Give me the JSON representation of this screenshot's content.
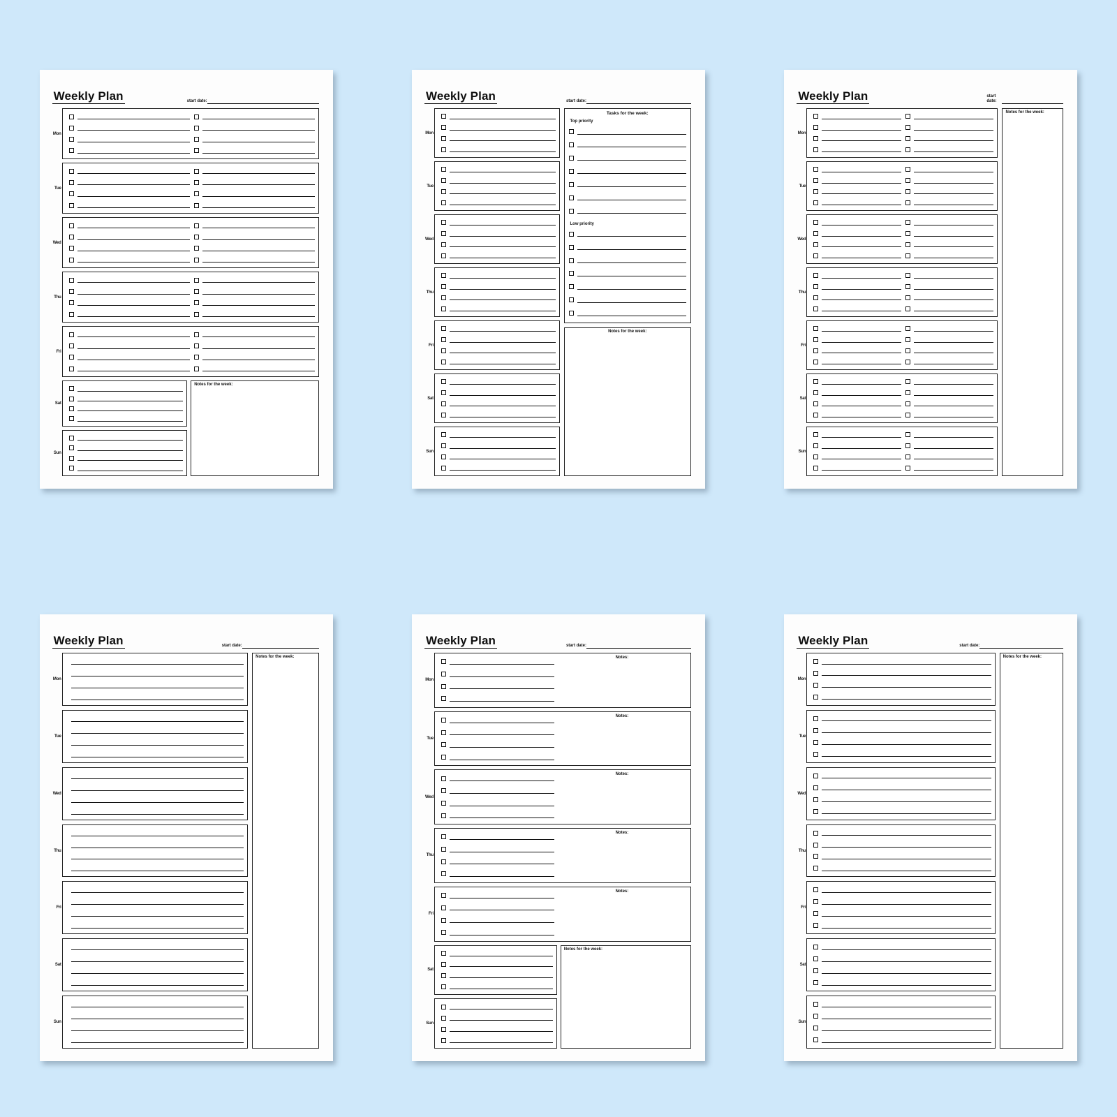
{
  "background_color": "#cfe8fa",
  "common": {
    "title": "Weekly Plan",
    "start_date_label": "start date:",
    "notes_week_label": "Notes for the week:",
    "notes_label": "Notes:",
    "days": [
      "Mon",
      "Tue",
      "Wed",
      "Thu",
      "Fri",
      "Sat",
      "Sun"
    ]
  },
  "pages": [
    {
      "id": "page-1",
      "variant": "two-column-checkbox-with-bottom-notes",
      "title": "Weekly Plan",
      "start_date_label": "start date:",
      "days": [
        "Mon",
        "Tue",
        "Wed",
        "Thu",
        "Fri",
        "Sat",
        "Sun"
      ],
      "rows_per_day": 4,
      "columns_per_row": 2,
      "weekend_columns": 1,
      "notes_week_label": "Notes for the week:"
    },
    {
      "id": "page-2",
      "variant": "single-column-with-tasks-panel",
      "title": "Weekly Plan",
      "start_date_label": "start date:",
      "days": [
        "Mon",
        "Tue",
        "Wed",
        "Thu",
        "Fri",
        "Sat",
        "Sun"
      ],
      "rows_per_day": 4,
      "columns_per_row": 1,
      "tasks_title": "Tasks for the week:",
      "top_priority_label": "Top priority",
      "low_priority_label": "Low priority",
      "top_priority_rows": 7,
      "low_priority_rows": 7,
      "notes_week_label": "Notes for the week:"
    },
    {
      "id": "page-3",
      "variant": "two-column-checkbox-with-side-notes",
      "title": "Weekly Plan",
      "start_date_label": "start date:",
      "days": [
        "Mon",
        "Tue",
        "Wed",
        "Thu",
        "Fri",
        "Sat",
        "Sun"
      ],
      "rows_per_day": 4,
      "columns_per_row": 2,
      "notes_week_label": "Notes for the week:"
    },
    {
      "id": "page-4",
      "variant": "lined-days-with-side-notes",
      "title": "Weekly Plan",
      "start_date_label": "start date:",
      "days": [
        "Mon",
        "Tue",
        "Wed",
        "Thu",
        "Fri",
        "Sat",
        "Sun"
      ],
      "rows_per_day": 4,
      "columns_per_row": 0,
      "notes_week_label": "Notes for the week:"
    },
    {
      "id": "page-5",
      "variant": "checkbox-days-with-per-day-notes",
      "title": "Weekly Plan",
      "start_date_label": "start date:",
      "days": [
        "Mon",
        "Tue",
        "Wed",
        "Thu",
        "Fri",
        "Sat",
        "Sun"
      ],
      "rows_per_day": 4,
      "columns_per_row": 1,
      "notes_label": "Notes:",
      "per_day_notes_days": [
        "Mon",
        "Tue",
        "Wed",
        "Thu",
        "Fri"
      ],
      "notes_week_label": "Notes for the week:"
    },
    {
      "id": "page-6",
      "variant": "single-column-checkbox-with-side-notes",
      "title": "Weekly Plan",
      "start_date_label": "start date:",
      "days": [
        "Mon",
        "Tue",
        "Wed",
        "Thu",
        "Fri",
        "Sat",
        "Sun"
      ],
      "rows_per_day": 4,
      "columns_per_row": 1,
      "notes_week_label": "Notes for the week:"
    }
  ]
}
